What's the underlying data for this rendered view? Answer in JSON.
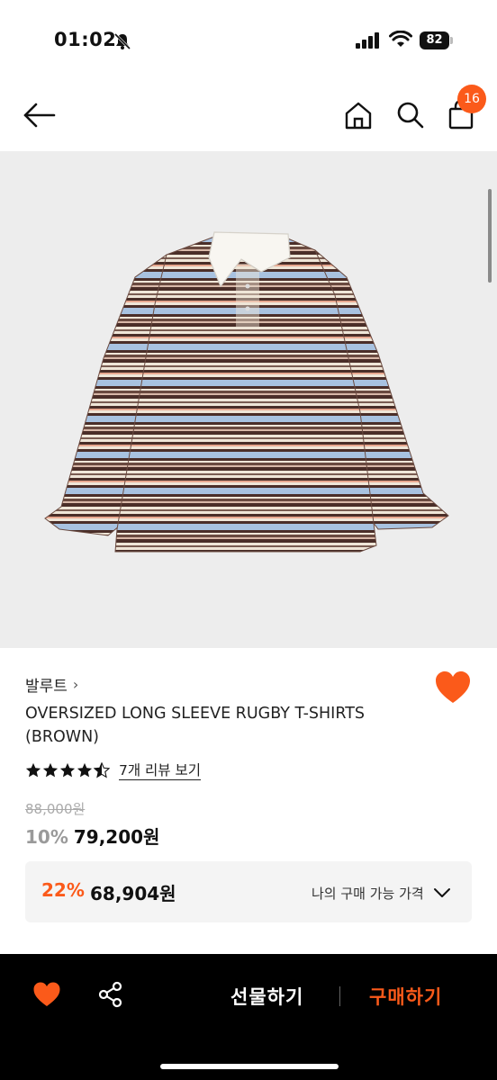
{
  "status_bar": {
    "time": "01:02",
    "battery": "82"
  },
  "header": {
    "cart_count": "16"
  },
  "product": {
    "brand": "발루트",
    "brand_chevron": "›",
    "title": "OVERSIZED LONG SLEEVE RUGBY T-SHIRTS (BROWN)",
    "rating": 4.5,
    "review_link": "7개 리뷰 보기",
    "original_price": "88,000원",
    "discount_rate": "10%",
    "sale_price": "79,200원",
    "my_price": {
      "discount": "22%",
      "price": "68,904원",
      "label": "나의 구매 가능 가격"
    }
  },
  "bottom_bar": {
    "gift_label": "선물하기",
    "buy_label": "구매하기"
  },
  "colors": {
    "accent": "#fb5a1a",
    "image_bg": "#ededed",
    "stripe_brown": "#5a3a32",
    "stripe_blue": "#a8c2e0",
    "stripe_cream": "#efe6d8"
  }
}
